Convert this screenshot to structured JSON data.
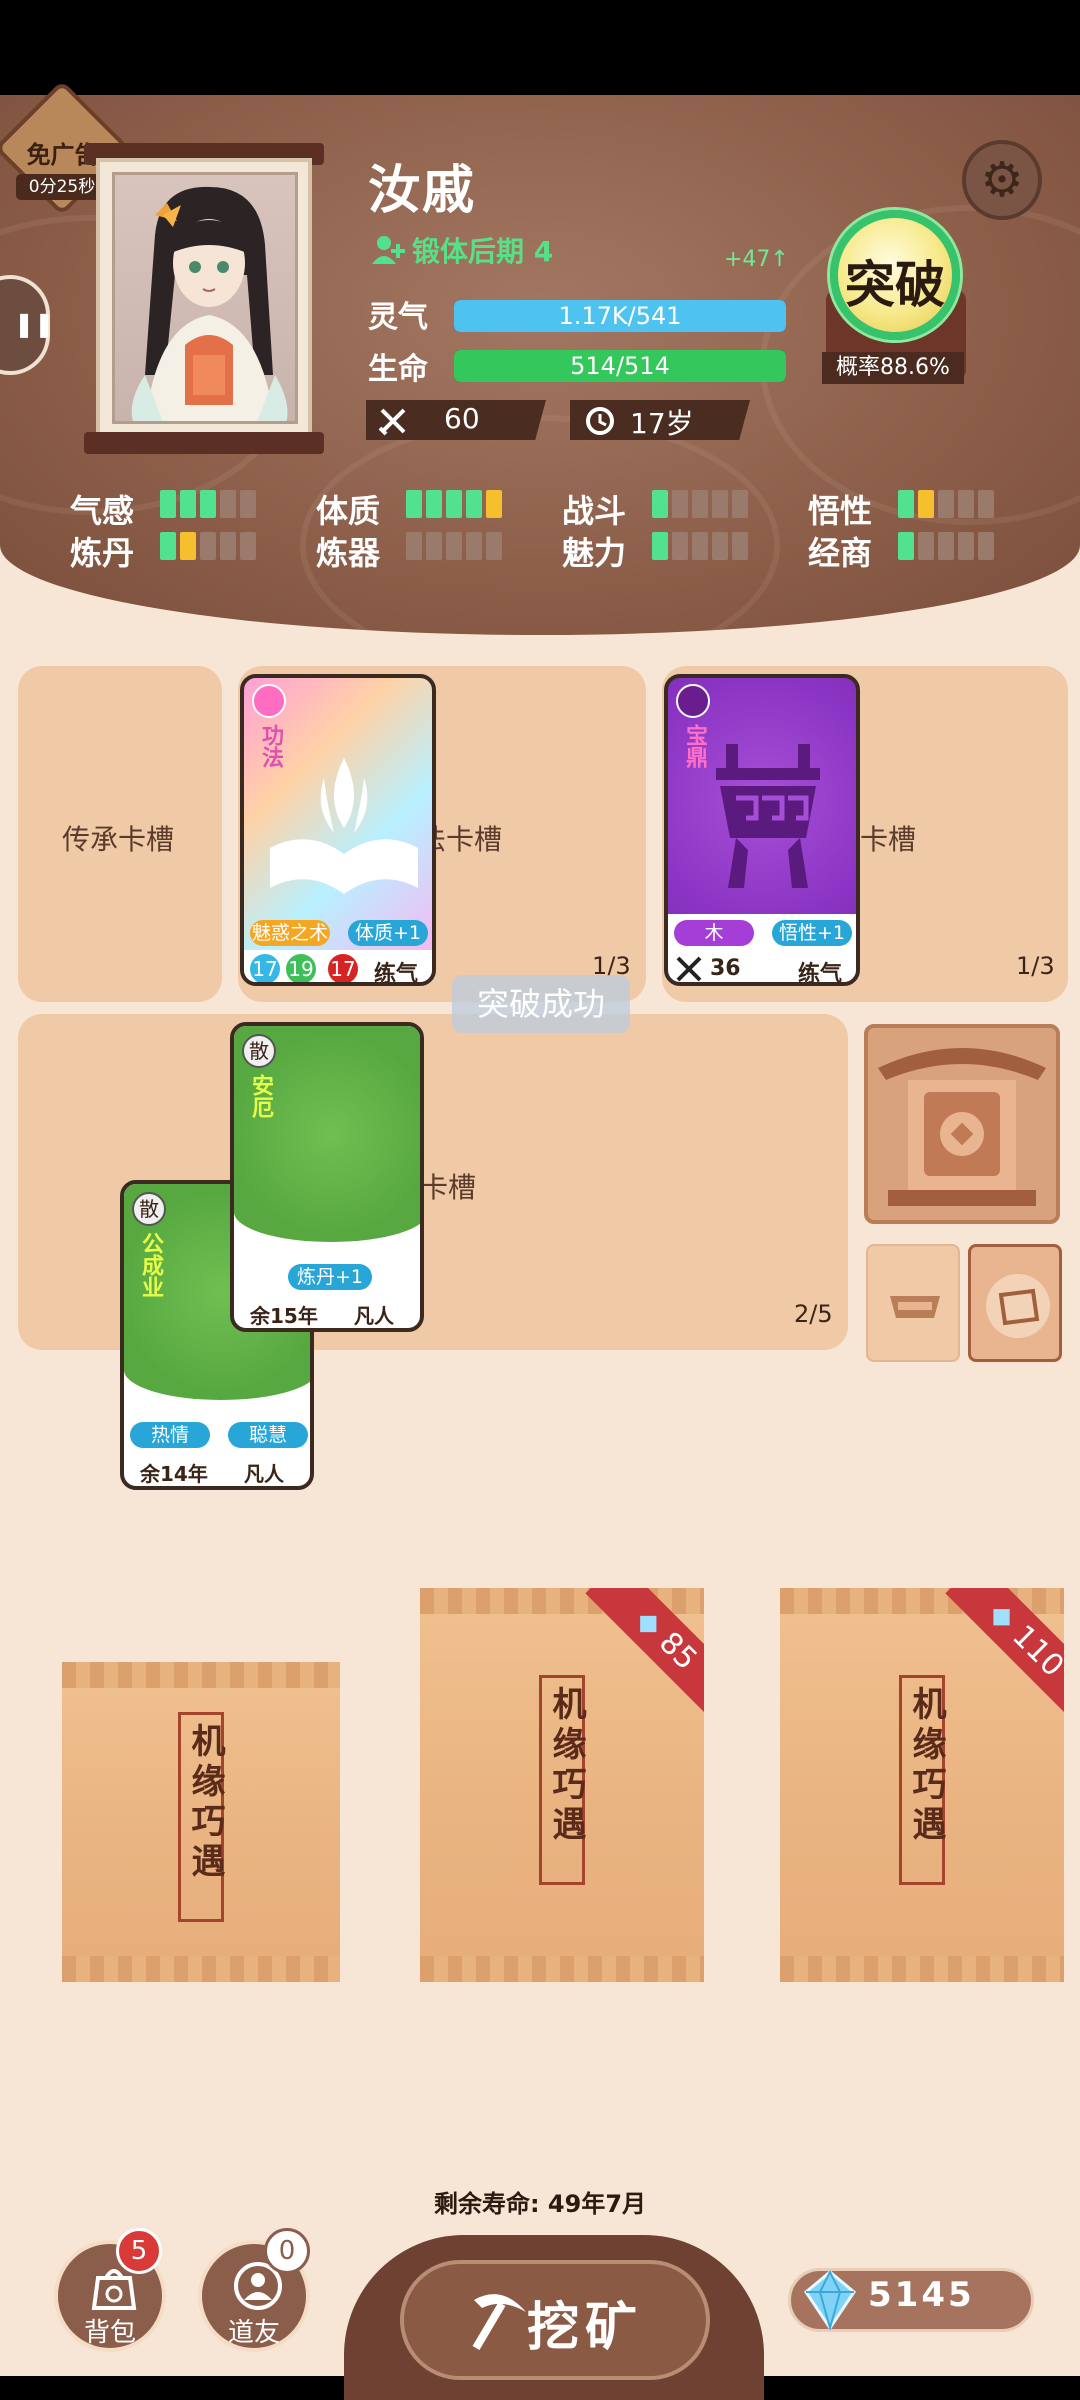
{
  "ad": {
    "label": "免广告",
    "timer": "0分25秒"
  },
  "character": {
    "name": "汝戚",
    "realm": "锻体后期 4",
    "realm_gain": "+47↑",
    "lingqi": {
      "label": "灵气",
      "text": "1.17K/541",
      "fill": 1.0
    },
    "life": {
      "label": "生命",
      "text": "514/514",
      "fill": 1.0
    },
    "power": "60",
    "age": "17岁"
  },
  "breakthrough": {
    "label": "突破",
    "probability": "概率88.6%"
  },
  "attributes": [
    {
      "label": "气感",
      "cells": [
        "g",
        "g",
        "g",
        "e",
        "e"
      ]
    },
    {
      "label": "体质",
      "cells": [
        "g",
        "g",
        "g",
        "g",
        "y"
      ]
    },
    {
      "label": "战斗",
      "cells": [
        "g",
        "e",
        "e",
        "e",
        "e"
      ]
    },
    {
      "label": "悟性",
      "cells": [
        "g",
        "y",
        "e",
        "e",
        "e"
      ]
    },
    {
      "label": "炼丹",
      "cells": [
        "g",
        "y",
        "e",
        "e",
        "e"
      ]
    },
    {
      "label": "炼器",
      "cells": [
        "e",
        "e",
        "e",
        "e",
        "e"
      ]
    },
    {
      "label": "魅力",
      "cells": [
        "g",
        "e",
        "e",
        "e",
        "e"
      ]
    },
    {
      "label": "经商",
      "cells": [
        "g",
        "e",
        "e",
        "e",
        "e"
      ]
    }
  ],
  "slots": {
    "inherit": {
      "label": "传承卡槽"
    },
    "skill": {
      "label_visible": "法卡槽",
      "count": "1/3"
    },
    "treasure": {
      "label_visible": "卡槽",
      "count": "1/3"
    },
    "companion": {
      "label_visible": "伴卡槽",
      "count": "2/5"
    }
  },
  "cards": {
    "skill": {
      "type": "功法",
      "tags": [
        "魅惑之术",
        "体质+1"
      ],
      "nums": [
        "17",
        "19",
        "17"
      ],
      "level": "练气"
    },
    "treasure": {
      "type": "宝鼎",
      "tags": [
        "木",
        "悟性+1"
      ],
      "power": "36",
      "level": "练气"
    },
    "anni": {
      "badge": "散",
      "name": "安厄",
      "tags": [
        "炼丹+1"
      ],
      "life": "余15年",
      "level": "凡人"
    },
    "gong": {
      "badge": "散",
      "name": "公成业",
      "tags": [
        "热情",
        "聪慧"
      ],
      "life": "余14年",
      "level": "凡人"
    }
  },
  "toast": "突破成功",
  "packs": [
    {
      "text": "机缘巧遇",
      "price": ""
    },
    {
      "text": "机缘巧遇",
      "price": "85"
    },
    {
      "text": "机缘巧遇",
      "price": "110"
    }
  ],
  "lifespan": "剩余寿命: 49年7月",
  "bottom": {
    "bag": {
      "label": "背包",
      "badge": "5"
    },
    "friends": {
      "label": "道友",
      "badge": "0"
    },
    "mine": "挖矿",
    "gems": "5145"
  },
  "colors": {
    "green": "#52e28f",
    "yellow": "#f5bf2e",
    "lingqi": "#4fc3f0",
    "life": "#34c75c"
  }
}
